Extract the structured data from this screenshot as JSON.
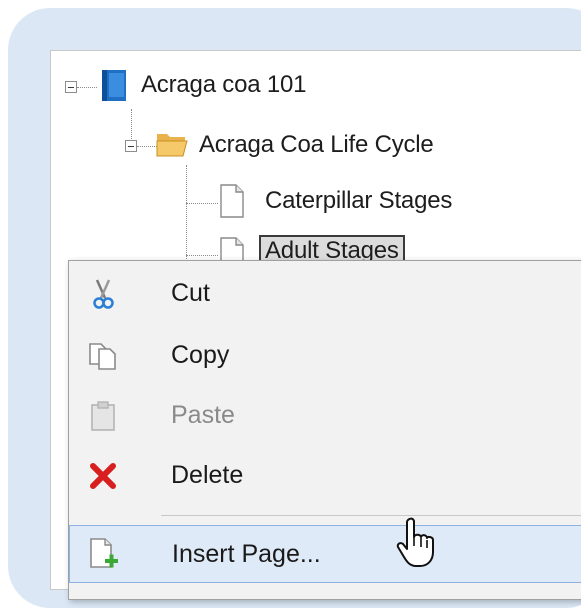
{
  "tree": {
    "root": {
      "label": "Acraga coa 101",
      "icon": "notebook-icon"
    },
    "section": {
      "label": "Acraga Coa Life Cycle",
      "icon": "folder-open-icon"
    },
    "pages": [
      {
        "label": "Caterpillar Stages",
        "icon": "page-icon",
        "selected": false
      },
      {
        "label": "Adult Stages",
        "icon": "page-icon",
        "selected": true
      }
    ]
  },
  "context_menu": {
    "items": [
      {
        "label": "Cut",
        "icon": "scissors-icon",
        "enabled": true
      },
      {
        "label": "Copy",
        "icon": "copy-icon",
        "enabled": true
      },
      {
        "label": "Paste",
        "icon": "paste-icon",
        "enabled": false
      },
      {
        "label": "Delete",
        "icon": "delete-x-icon",
        "enabled": true
      },
      {
        "label": "Insert Page...",
        "icon": "insert-page-icon",
        "enabled": true,
        "highlighted": true
      }
    ]
  },
  "colors": {
    "frame_background": "#dbe7f5",
    "menu_highlight": "#dfeaf8",
    "menu_highlight_border": "#8fb3e0",
    "delete_red": "#d81e1e",
    "insert_green": "#3aa835",
    "notebook_blue": "#1f6fc4"
  }
}
